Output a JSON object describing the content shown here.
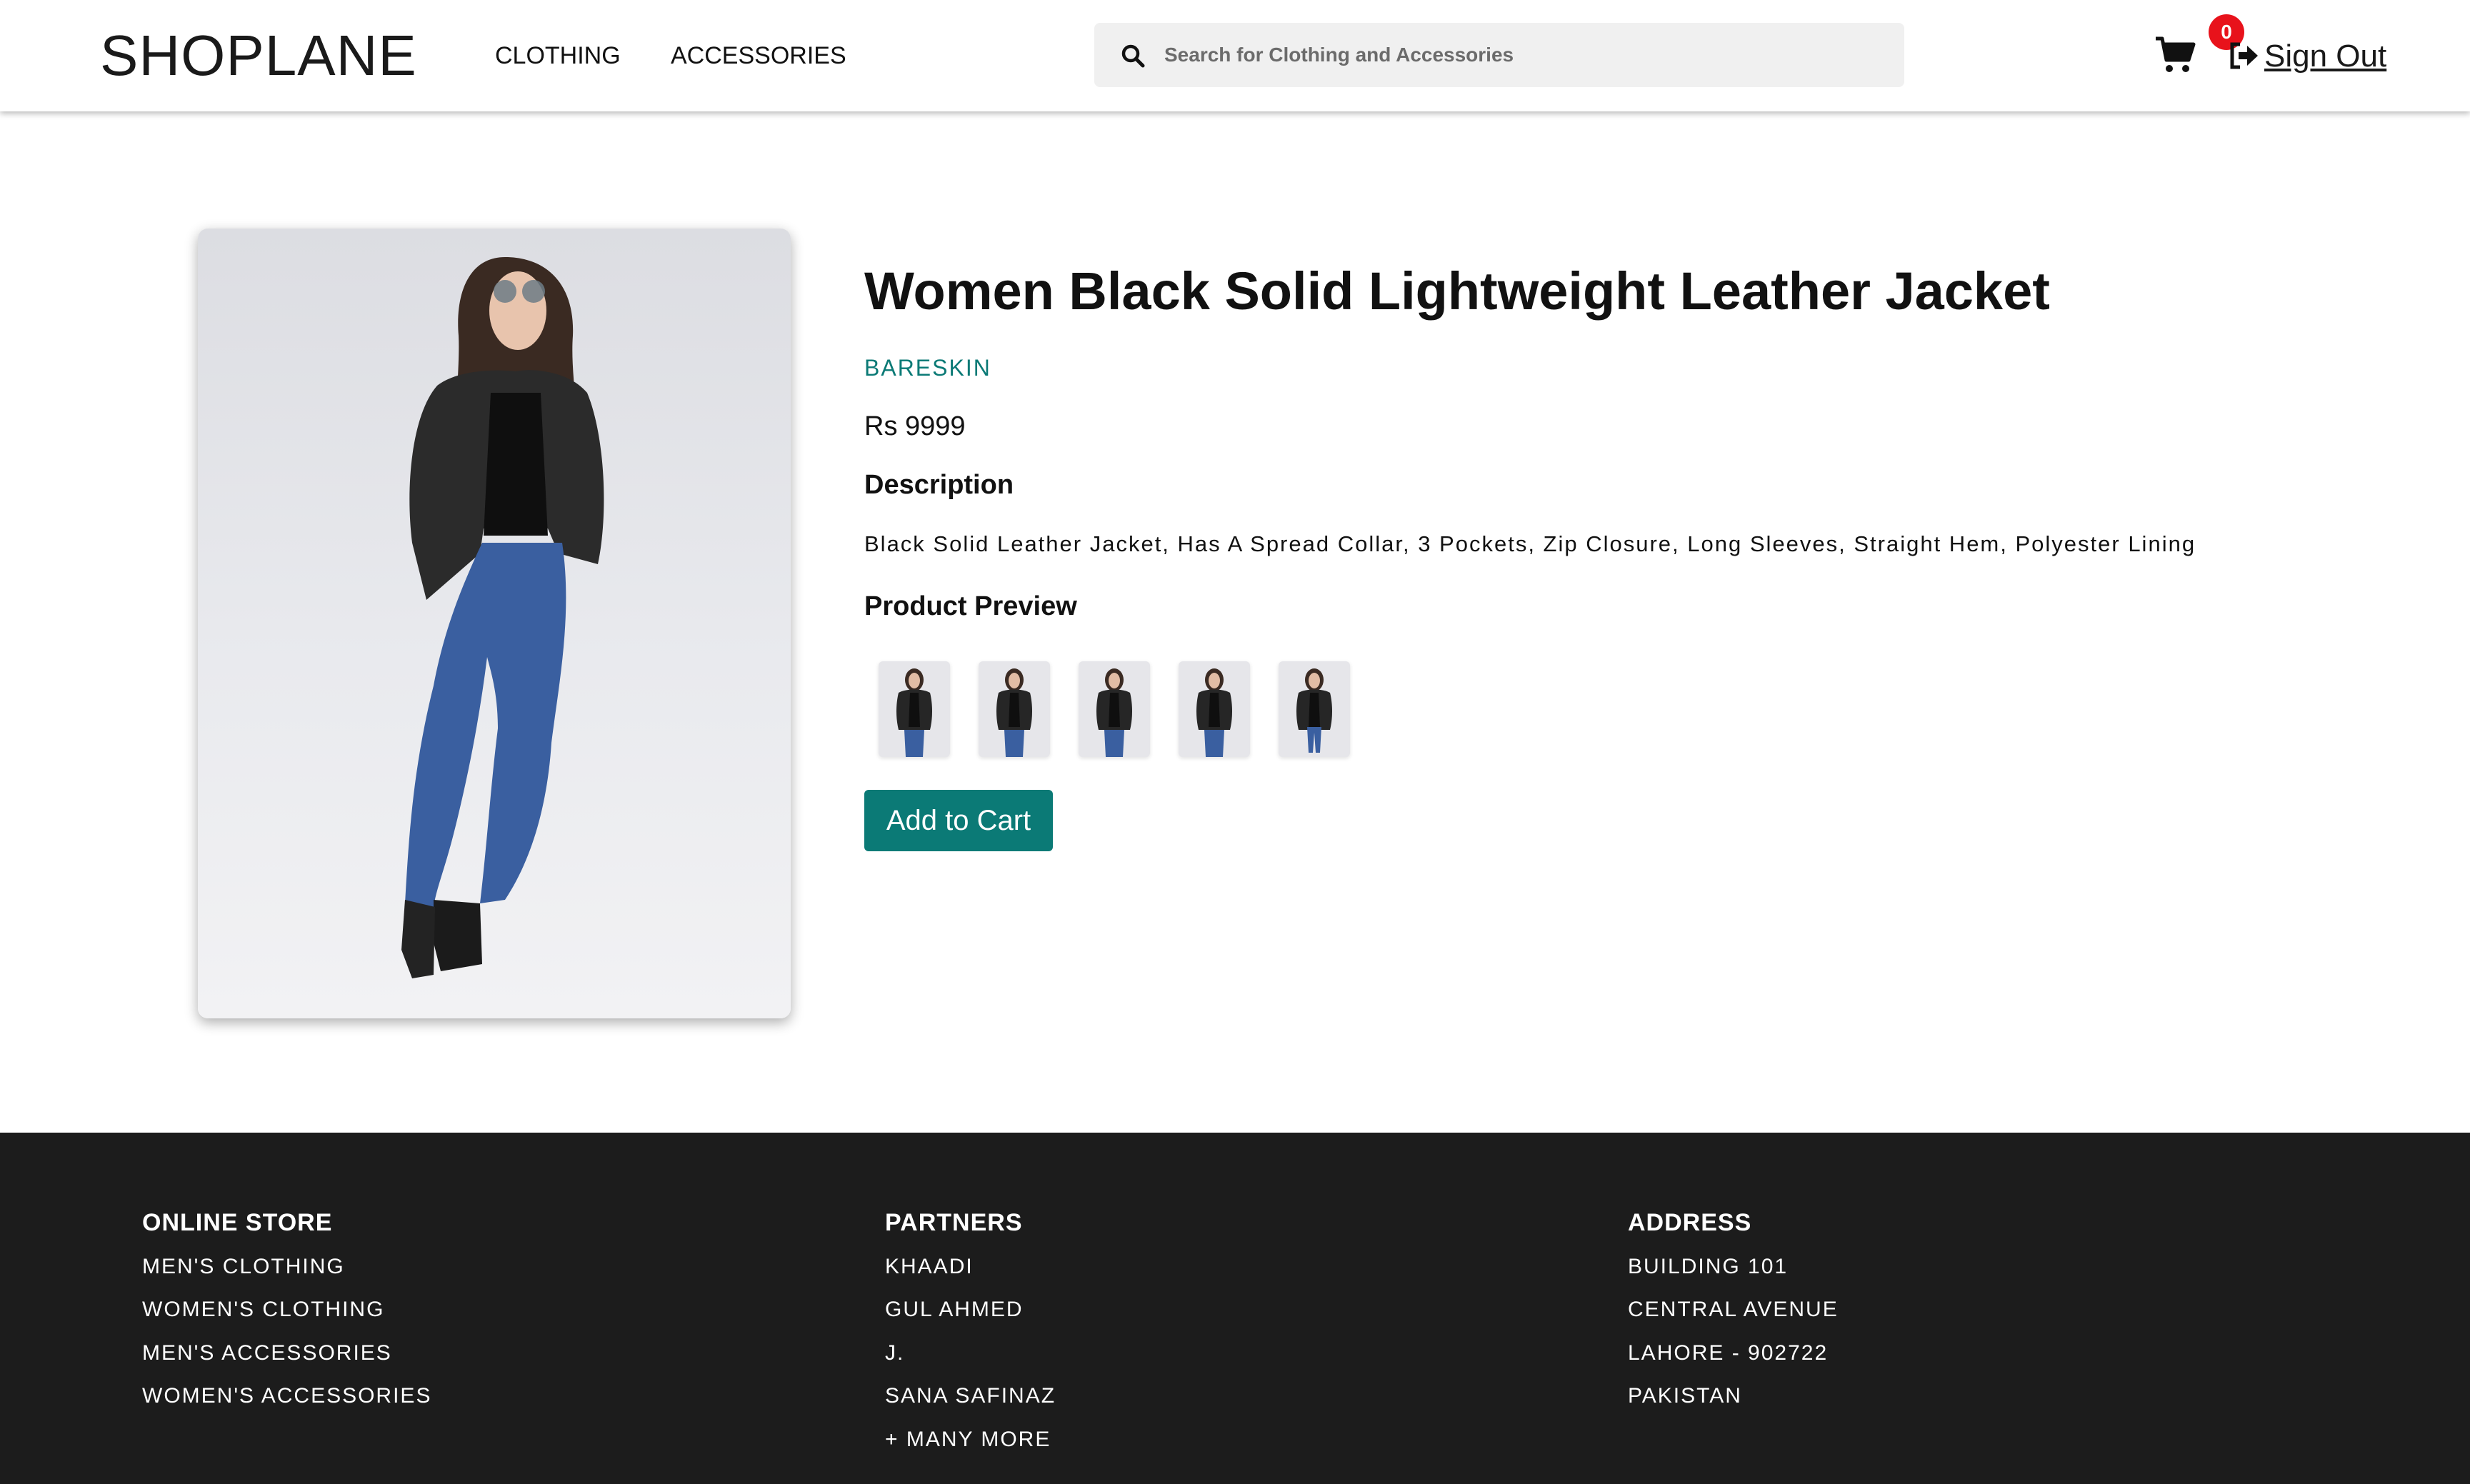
{
  "header": {
    "logo": "SHOPLANE",
    "nav": [
      "CLOTHING",
      "ACCESSORIES"
    ],
    "search_placeholder": "Search for Clothing and Accessories",
    "cart_count": "0",
    "signout_label": "Sign Out"
  },
  "product": {
    "title": "Women Black Solid Lightweight Leather Jacket",
    "brand": "BARESKIN",
    "price": "Rs 9999",
    "description_heading": "Description",
    "description": "Black Solid Leather Jacket, Has A Spread Collar, 3 Pockets, Zip Closure, Long Sleeves, Straight Hem, Polyester Lining",
    "preview_heading": "Product Preview",
    "preview_count": 5,
    "add_to_cart": "Add to Cart"
  },
  "footer": {
    "columns": [
      {
        "heading": "ONLINE STORE",
        "items": [
          "MEN'S CLOTHING",
          "WOMEN'S CLOTHING",
          "MEN'S ACCESSORIES",
          "WOMEN'S ACCESSORIES"
        ]
      },
      {
        "heading": "PARTNERS",
        "items": [
          "KHAADI",
          "GUL AHMED",
          "J.",
          "SANA SAFINAZ",
          "+ MANY MORE"
        ]
      },
      {
        "heading": "ADDRESS",
        "items": [
          "BUILDING 101",
          "CENTRAL AVENUE",
          "LAHORE - 902722",
          "PAKISTAN"
        ]
      }
    ]
  },
  "colors": {
    "accent": "#0b7a76",
    "badge": "#e8121b",
    "footer_bg": "#1c1c1c"
  },
  "icons": [
    "search-icon",
    "shopping-cart-icon",
    "sign-out-icon"
  ]
}
